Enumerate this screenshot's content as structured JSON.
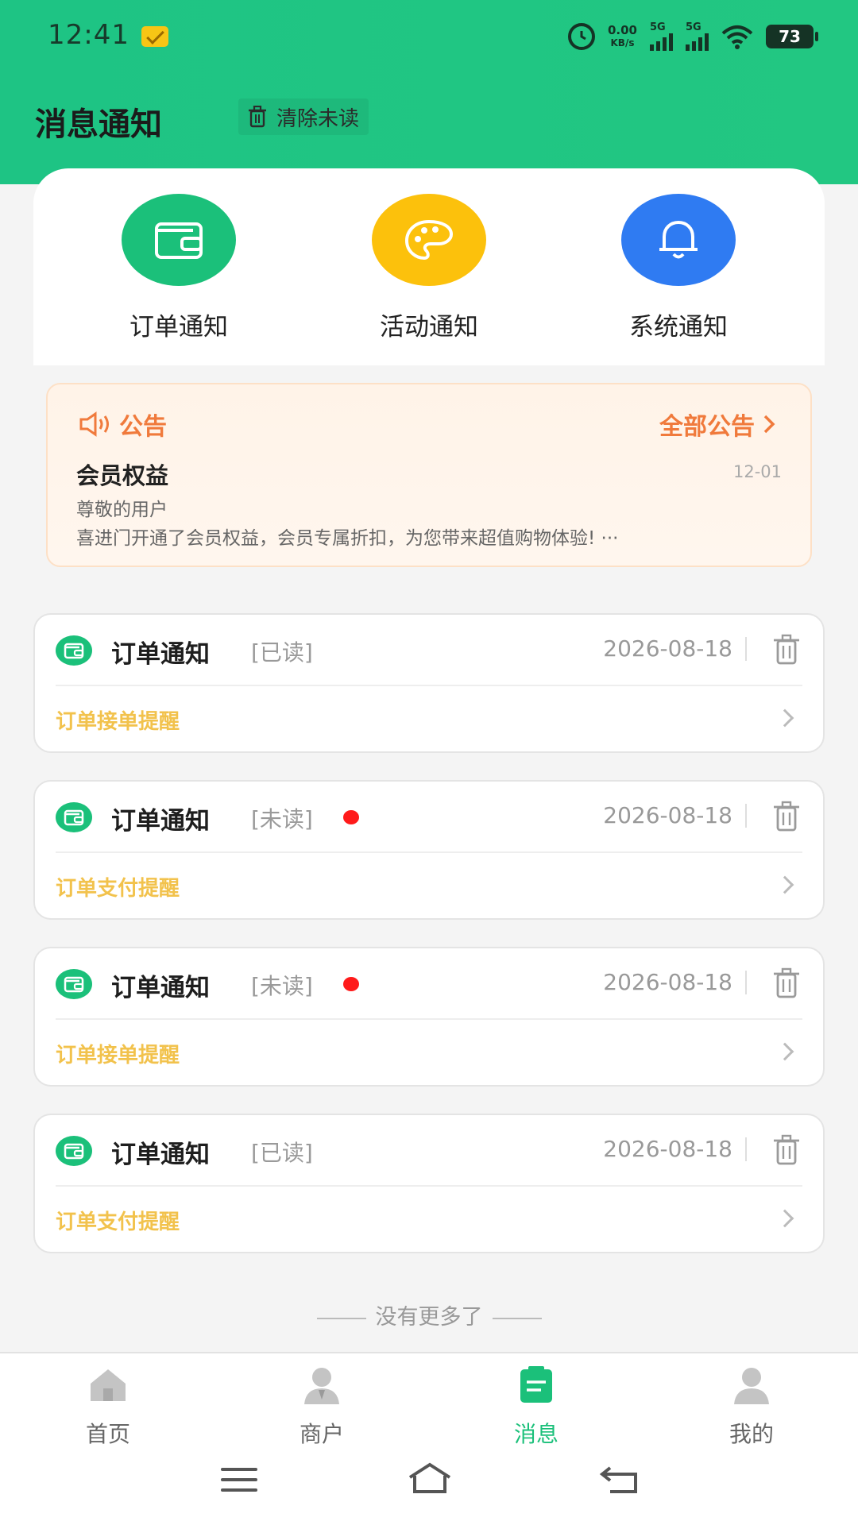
{
  "status_bar": {
    "time": "12:41",
    "net_speed_value": "0.00",
    "net_speed_unit": "KB/s",
    "sim1_type": "5G",
    "sim2_type": "5G",
    "battery": "73"
  },
  "header": {
    "title": "消息通知",
    "clear_label": "清除未读"
  },
  "categories": [
    {
      "label": "订单通知",
      "color": "#1bc07a",
      "icon": "wallet-icon"
    },
    {
      "label": "活动通知",
      "color": "#fcc10c",
      "icon": "palette-icon"
    },
    {
      "label": "系统通知",
      "color": "#2f7bf2",
      "icon": "bell-icon"
    }
  ],
  "announcement": {
    "label": "公告",
    "all_label": "全部公告",
    "title": "会员权益",
    "date": "12-01",
    "line1": "尊敬的用户",
    "line2": "喜进门开通了会员权益，会员专属折扣，为您带来超值购物体验! ···"
  },
  "messages": [
    {
      "title": "订单通知",
      "status": "[已读]",
      "unread": false,
      "date": "2026-08-18",
      "subtitle": "订单接单提醒"
    },
    {
      "title": "订单通知",
      "status": "[未读]",
      "unread": true,
      "date": "2026-08-18",
      "subtitle": "订单支付提醒"
    },
    {
      "title": "订单通知",
      "status": "[未读]",
      "unread": true,
      "date": "2026-08-18",
      "subtitle": "订单接单提醒"
    },
    {
      "title": "订单通知",
      "status": "[已读]",
      "unread": false,
      "date": "2026-08-18",
      "subtitle": "订单支付提醒"
    }
  ],
  "footer_text": "没有更多了",
  "tabbar": [
    {
      "label": "首页",
      "icon": "home-icon",
      "active": false
    },
    {
      "label": "商户",
      "icon": "merchant-icon",
      "active": false
    },
    {
      "label": "消息",
      "icon": "message-icon",
      "active": true
    },
    {
      "label": "我的",
      "icon": "profile-icon",
      "active": false
    }
  ],
  "colors": {
    "brand_green": "#1bc07a",
    "announcement_orange": "#f07a3c",
    "subtitle_yellow": "#f2c24c",
    "unread_red": "#ff1a1a"
  }
}
